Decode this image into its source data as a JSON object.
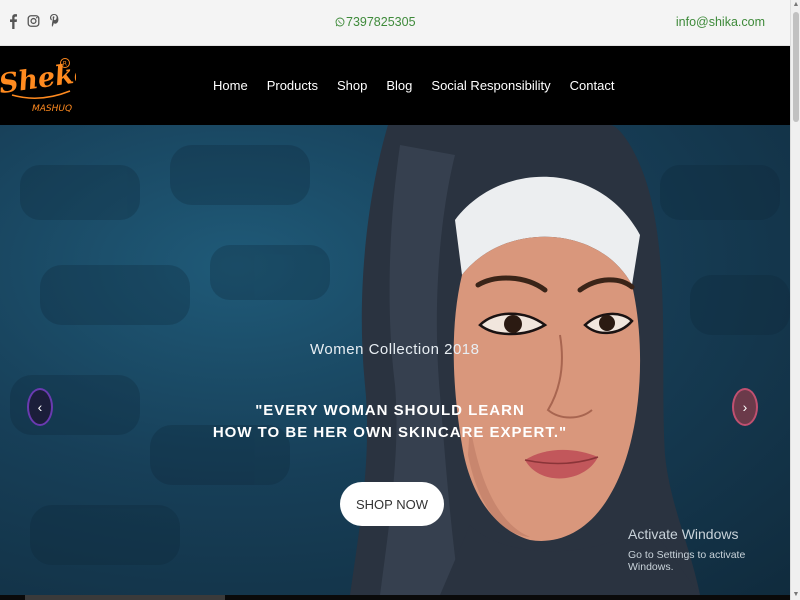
{
  "topbar": {
    "social_icons": [
      "facebook-icon",
      "instagram-icon",
      "pinterest-icon"
    ],
    "phone": "7397825305",
    "phone_icon": "whatsapp-icon",
    "email": "info@shika.com"
  },
  "brand": {
    "name": "Sheka",
    "tagline": "MASHUQ",
    "mark": "R",
    "color": "#ff8a1f"
  },
  "nav": {
    "items": [
      "Home",
      "Products",
      "Shop",
      "Blog",
      "Social Responsibility",
      "Contact"
    ]
  },
  "hero": {
    "kicker": "Women Collection 2018",
    "quote_line1": "\"EVERY WOMAN SHOULD LEARN",
    "quote_line2": "HOW TO BE HER OWN SKINCARE EXPERT.\"",
    "cta": "SHOP NOW",
    "prev_arrow": "‹",
    "next_arrow": "›"
  },
  "overlay": {
    "activate_title": "Activate Windows",
    "activate_sub": "Go to Settings to activate Windows."
  },
  "colors": {
    "accent_green": "#3e8a3a",
    "nav_bg": "#000000",
    "hero_bg": "#173f58"
  }
}
